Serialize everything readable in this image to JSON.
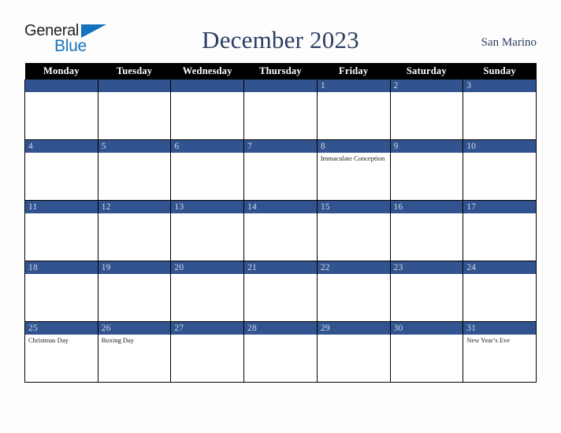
{
  "brand": {
    "name_part1": "General",
    "name_part2": "Blue",
    "accent_color": "#1673bb",
    "text_color": "#231f20"
  },
  "header": {
    "title": "December 2023",
    "location": "San Marino",
    "title_color": "#2c3e63"
  },
  "calendar": {
    "weekday_headers": [
      "Monday",
      "Tuesday",
      "Wednesday",
      "Thursday",
      "Friday",
      "Saturday",
      "Sunday"
    ],
    "header_background": "#000000",
    "daybar_color": "#31538f",
    "daynumber_color": "#d6d9e4",
    "weeks": [
      {
        "days": [
          {
            "date": "",
            "events": []
          },
          {
            "date": "",
            "events": []
          },
          {
            "date": "",
            "events": []
          },
          {
            "date": "",
            "events": []
          },
          {
            "date": "1",
            "events": []
          },
          {
            "date": "2",
            "events": []
          },
          {
            "date": "3",
            "events": []
          }
        ]
      },
      {
        "days": [
          {
            "date": "4",
            "events": []
          },
          {
            "date": "5",
            "events": []
          },
          {
            "date": "6",
            "events": []
          },
          {
            "date": "7",
            "events": []
          },
          {
            "date": "8",
            "events": [
              "Immaculate Conception"
            ]
          },
          {
            "date": "9",
            "events": []
          },
          {
            "date": "10",
            "events": []
          }
        ]
      },
      {
        "days": [
          {
            "date": "11",
            "events": []
          },
          {
            "date": "12",
            "events": []
          },
          {
            "date": "13",
            "events": []
          },
          {
            "date": "14",
            "events": []
          },
          {
            "date": "15",
            "events": []
          },
          {
            "date": "16",
            "events": []
          },
          {
            "date": "17",
            "events": []
          }
        ]
      },
      {
        "days": [
          {
            "date": "18",
            "events": []
          },
          {
            "date": "19",
            "events": []
          },
          {
            "date": "20",
            "events": []
          },
          {
            "date": "21",
            "events": []
          },
          {
            "date": "22",
            "events": []
          },
          {
            "date": "23",
            "events": []
          },
          {
            "date": "24",
            "events": []
          }
        ]
      },
      {
        "days": [
          {
            "date": "25",
            "events": [
              "Christmas Day"
            ]
          },
          {
            "date": "26",
            "events": [
              "Boxing Day"
            ]
          },
          {
            "date": "27",
            "events": []
          },
          {
            "date": "28",
            "events": []
          },
          {
            "date": "29",
            "events": []
          },
          {
            "date": "30",
            "events": []
          },
          {
            "date": "31",
            "events": [
              "New Year’s Eve"
            ]
          }
        ]
      }
    ]
  }
}
